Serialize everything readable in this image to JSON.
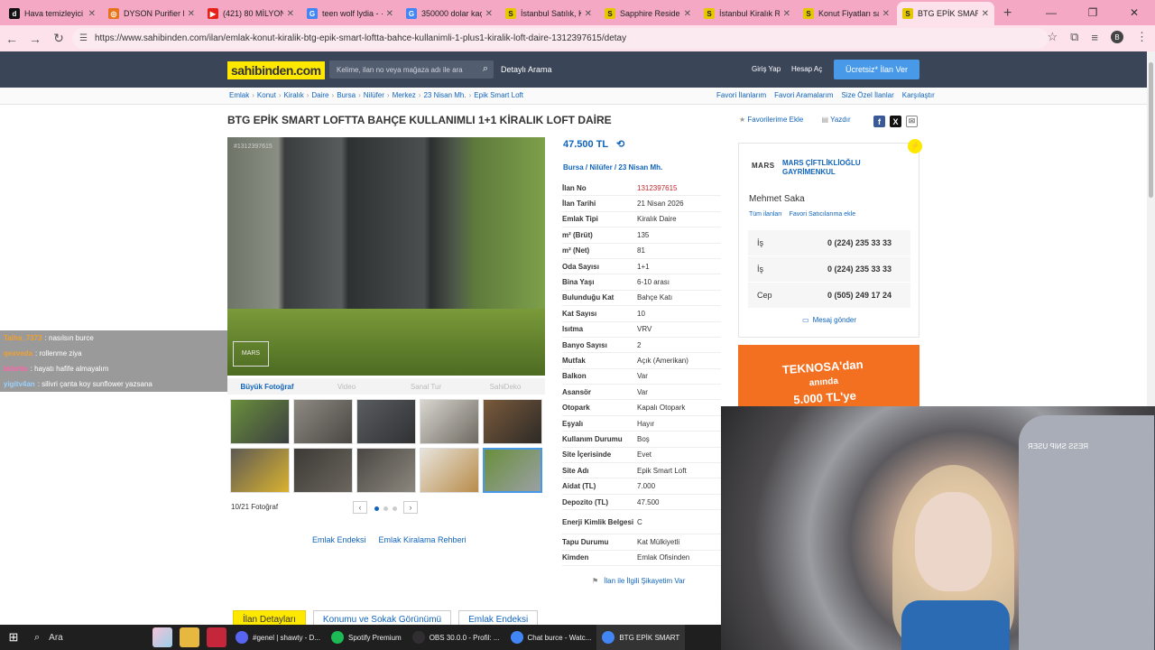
{
  "browser": {
    "tabs": [
      {
        "title": "Hava temizleyici ά",
        "favicon": "d",
        "color": "#111111"
      },
      {
        "title": "DYSON Purifier H",
        "favicon": "◎",
        "color": "#e8731a"
      },
      {
        "title": "(421) 80 MİLYON",
        "favicon": "▶",
        "color": "#e62117"
      },
      {
        "title": "teen wolf lydia - ·",
        "favicon": "G",
        "color": "#4285f4"
      },
      {
        "title": "350000 dolar kaç",
        "favicon": "G",
        "color": "#4285f4"
      },
      {
        "title": "İstanbul Satılık, Ki",
        "favicon": "S",
        "color": "#e6c800"
      },
      {
        "title": "Sapphire Residen",
        "favicon": "S",
        "color": "#e6c800"
      },
      {
        "title": "İstanbul Kiralık Re",
        "favicon": "S",
        "color": "#e6c800"
      },
      {
        "title": "Konut Fiyatları sa",
        "favicon": "S",
        "color": "#e6c800"
      },
      {
        "title": "BTG EPİK SMART",
        "favicon": "S",
        "color": "#e6c800",
        "active": true
      }
    ],
    "new_tab": "+",
    "url": "https://www.sahibinden.com/ilan/emlak-konut-kiralik-btg-epik-smart-loftta-bahce-kullanimli-1-plus1-kiralik-loft-daire-1312397615/detay",
    "avatar": "B"
  },
  "site": {
    "logo": "sahibinden.com",
    "search_placeholder": "Kelime, ilan no veya mağaza adı ile ara",
    "detayli": "Detaylı Arama",
    "giris": "Giriş Yap",
    "hesap": "Hesap Aç",
    "ucretsiz": "Ücretsiz* İlan Ver",
    "breadcrumbs": [
      "Emlak",
      "Konut",
      "Kiralık",
      "Daire",
      "Bursa",
      "Nilüfer",
      "Merkez",
      "23 Nisan Mh.",
      "Epik Smart Loft"
    ],
    "right_links": [
      "Favori İlanlarım",
      "Favori Aramalarım",
      "Size Özel İlanlar",
      "Karşılaştır"
    ]
  },
  "listing": {
    "title": "BTG EPİK SMART LOFTTA BAHÇE KULLANIMLI 1+1 KİRALIK LOFT DAİRE",
    "fav_action": "Favorilerime Ekle",
    "print_action": "Yazdır",
    "photo_id": "#1312397615",
    "photo_watermark": "MARS",
    "photo_tabs": [
      "Büyük Fotoğraf",
      "Video",
      "Sanal Tur",
      "SahiDeko"
    ],
    "photo_count": "10/21 Fotoğraf",
    "price": "47.500 TL",
    "location": [
      "Bursa",
      "Nilüfer",
      "23 Nisan Mh."
    ],
    "specs": [
      [
        "İlan No",
        "1312397615"
      ],
      [
        "İlan Tarihi",
        "21 Nisan 2026"
      ],
      [
        "Emlak Tipi",
        "Kiralık Daire"
      ],
      [
        "m² (Brüt)",
        "135"
      ],
      [
        "m² (Net)",
        "81"
      ],
      [
        "Oda Sayısı",
        "1+1"
      ],
      [
        "Bina Yaşı",
        "6-10 arası"
      ],
      [
        "Bulunduğu Kat",
        "Bahçe Katı"
      ],
      [
        "Kat Sayısı",
        "10"
      ],
      [
        "Isıtma",
        "VRV"
      ],
      [
        "Banyo Sayısı",
        "2"
      ],
      [
        "Mutfak",
        "Açık (Amerikan)"
      ],
      [
        "Balkon",
        "Var"
      ],
      [
        "Asansör",
        "Var"
      ],
      [
        "Otopark",
        "Kapalı Otopark"
      ],
      [
        "Eşyalı",
        "Hayır"
      ],
      [
        "Kullanım Durumu",
        "Boş"
      ],
      [
        "Site İçerisinde",
        "Evet"
      ],
      [
        "Site Adı",
        "Epik Smart Loft"
      ],
      [
        "Aidat (TL)",
        "7.000"
      ],
      [
        "Depozito (TL)",
        "47.500"
      ],
      [
        "Enerji Kimlik Belgesi",
        "C"
      ],
      [
        "Tapu Durumu",
        "Kat Mülkiyetli"
      ],
      [
        "Kimden",
        "Emlak Ofisinden"
      ]
    ],
    "complaint": "İlan ile İlgili Şikayetim Var",
    "endeks": [
      "Emlak Endeksi",
      "Emlak Kiralama Rehberi"
    ],
    "bottom_tabs": [
      "İlan Detayları",
      "Konumu ve Sokak Görünümü",
      "Emlak Endeksi"
    ]
  },
  "seller": {
    "logo_text": "MARS",
    "firm": "MARS ÇİFTLİKLİOĞLU GAYRİMENKUL",
    "agent": "Mehmet Saka",
    "links": [
      "Tüm ilanları",
      "Favori Satıcılarıma ekle"
    ],
    "phones": [
      [
        "İş",
        "0 (224) 235 33 33"
      ],
      [
        "İş",
        "0 (224) 235 33 33"
      ],
      [
        "Cep",
        "0 (505) 249 17 24"
      ]
    ],
    "message": "Mesaj gönder"
  },
  "ad": {
    "text_line1": "TEKNOSA'dan",
    "text_line2": "anında",
    "text_line3": "5.000 TL'ye"
  },
  "chat": [
    {
      "user": "Talha_7373",
      "color": "#f0a030",
      "msg": ": nasılsın burce"
    },
    {
      "user": "qexveda",
      "color": "#f0a030",
      "msg": ": rollenme ziya"
    },
    {
      "user": "lafortis",
      "color": "#ff66aa",
      "msg": ": hayatı hafife almayalım"
    },
    {
      "user": "yigitv4an",
      "color": "#9ad1ff",
      "msg": ": silivri çanta koy sunflower yazsana"
    }
  ],
  "webcam_sign": "RESS SNIP USER",
  "taskbar": {
    "search": "Ara",
    "apps": [
      "#genel | shawty - D...",
      "Spotify Premium",
      "OBS 30.0.0 - Profil: ...",
      "Chat burce - Watc...",
      "BTG EPİK SMART"
    ]
  },
  "colors": {
    "brand_yellow": "#ffe800",
    "link_blue": "#1064bc",
    "header_dark": "#3a4558",
    "cta_blue": "#489ae9",
    "tab_pink": "#f4a8c4"
  }
}
